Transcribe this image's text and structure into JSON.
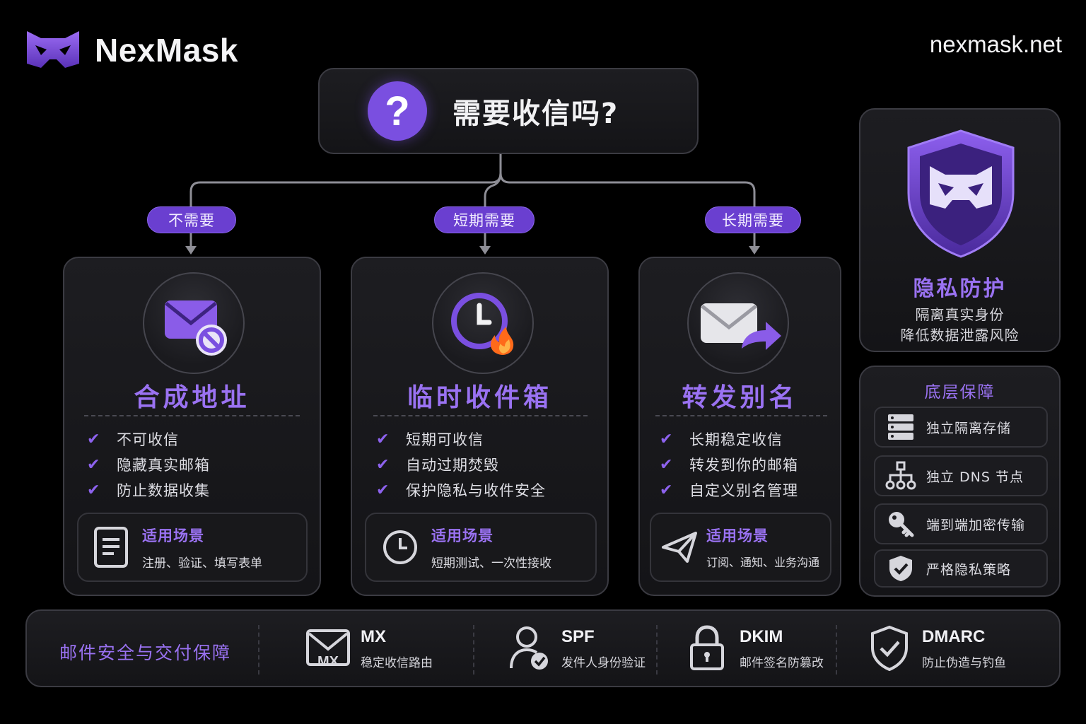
{
  "header": {
    "brand_name": "NexMask",
    "site_url": "nexmask.net"
  },
  "question": {
    "text": "需要收信吗?",
    "badge": "?"
  },
  "branches": [
    {
      "label": "不需要",
      "title": "合成地址",
      "icon": "envelope-blocked-icon",
      "features": [
        "不可收信",
        "隐藏真实邮箱",
        "防止数据收集"
      ],
      "scenario": {
        "title": "适用场景",
        "desc": "注册、验证、填写表单",
        "icon": "document-icon"
      }
    },
    {
      "label": "短期需要",
      "title": "临时收件箱",
      "icon": "clock-fire-icon",
      "features": [
        "短期可收信",
        "自动过期焚毁",
        "保护隐私与收件安全"
      ],
      "scenario": {
        "title": "适用场景",
        "desc": "短期测试、一次性接收",
        "icon": "clock-icon"
      }
    },
    {
      "label": "长期需要",
      "title": "转发别名",
      "icon": "envelope-forward-icon",
      "features": [
        "长期稳定收信",
        "转发到你的邮箱",
        "自定义别名管理"
      ],
      "scenario": {
        "title": "适用场景",
        "desc": "订阅、通知、业务沟通",
        "icon": "paper-plane-icon"
      }
    }
  ],
  "privacy": {
    "title": "隐私防护",
    "lines": [
      "隔离真实身份",
      "降低数据泄露风险"
    ],
    "icon": "shield-mask-icon"
  },
  "base": {
    "title": "底层保障",
    "items": [
      {
        "label": "独立隔离存储",
        "icon": "server-icon"
      },
      {
        "label": "独立 DNS 节点",
        "icon": "network-icon"
      },
      {
        "label": "端到端加密传输",
        "icon": "key-icon"
      },
      {
        "label": "严格隐私策略",
        "icon": "shield-check-icon"
      }
    ]
  },
  "security": {
    "title": "邮件安全与交付保障",
    "items": [
      {
        "name": "MX",
        "desc": "稳定收信路由",
        "icon": "mx-envelope-icon",
        "icon_text": "MX"
      },
      {
        "name": "SPF",
        "desc": "发件人身份验证",
        "icon": "user-check-icon"
      },
      {
        "name": "DKIM",
        "desc": "邮件签名防篡改",
        "icon": "lock-icon"
      },
      {
        "name": "DMARC",
        "desc": "防止伪造与钓鱼",
        "icon": "shield-check-icon"
      }
    ]
  },
  "colors": {
    "accent": "#7a4fe0",
    "accent_light": "#9a72f2",
    "background": "#000000",
    "panel": "#18181b",
    "fire": "#ff6a1a"
  }
}
